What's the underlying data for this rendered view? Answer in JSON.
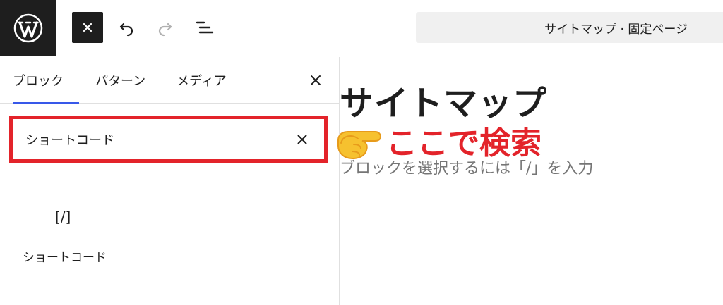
{
  "topbar": {
    "logo": "wordpress-logo",
    "close_icon": "close-icon",
    "undo_icon": "undo-icon",
    "redo_icon": "redo-icon",
    "list_view_icon": "list-view-icon",
    "document_title": "サイトマップ · 固定ページ"
  },
  "sidebar": {
    "tabs": [
      {
        "label": "ブロック",
        "active": true
      },
      {
        "label": "パターン",
        "active": false
      },
      {
        "label": "メディア",
        "active": false
      }
    ],
    "close_icon": "close-icon",
    "search": {
      "value": "ショートコード",
      "clear_icon": "close-icon"
    },
    "results": [
      {
        "icon_text": "[/]",
        "label": "ショートコード"
      }
    ]
  },
  "editor": {
    "page_title": "サイトマップ",
    "block_placeholder": "ブロックを選択するには「/」を入力"
  },
  "annotation": {
    "icon": "pointing-hand-icon",
    "text": "ここで検索",
    "color": "#e3232a"
  },
  "colors": {
    "accent": "#3858e9",
    "dark": "#1e1e1e",
    "highlight": "#e3232a",
    "docbar_bg": "#f0f0f0"
  }
}
